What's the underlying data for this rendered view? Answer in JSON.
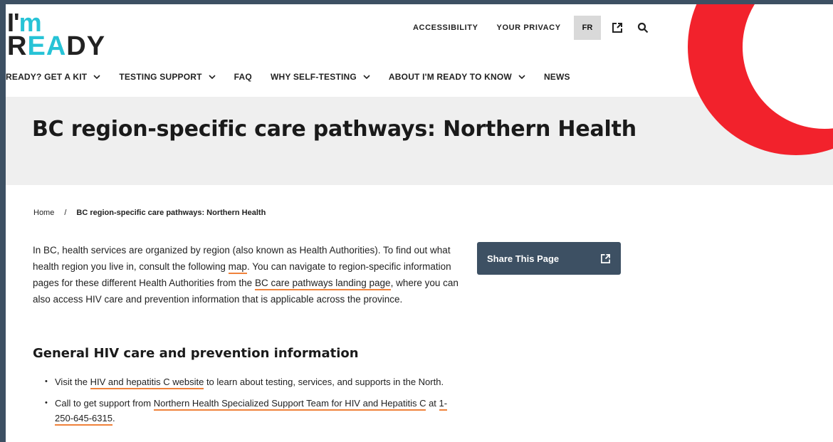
{
  "logo": {
    "line1_a": "I'",
    "line1_b": "m",
    "line2_a": "R",
    "line2_b": "E",
    "line2_c": "A",
    "line2_d": "DY"
  },
  "utility": {
    "accessibility": "ACCESSIBILITY",
    "privacy": "YOUR PRIVACY",
    "language": "FR",
    "external_icon": "external-link-icon",
    "search_icon": "search-icon"
  },
  "nav": {
    "items": [
      {
        "label": "READY? GET A KIT",
        "dropdown": true
      },
      {
        "label": "TESTING SUPPORT",
        "dropdown": true
      },
      {
        "label": "FAQ",
        "dropdown": false
      },
      {
        "label": "WHY SELF-TESTING",
        "dropdown": true
      },
      {
        "label": "ABOUT I'M READY TO KNOW",
        "dropdown": true
      },
      {
        "label": "NEWS",
        "dropdown": false
      }
    ]
  },
  "hero": {
    "title": "BC region-specific care pathways: Northern Health"
  },
  "breadcrumb": {
    "home": "Home",
    "separator": "/",
    "current": "BC region-specific care pathways: Northern Health"
  },
  "intro": {
    "t1": "In BC, health services are organized by region (also known as Health Authorities). To find out what health region you live in, consult the following ",
    "link_map": "map",
    "t2": ". You can navigate to region-specific information pages for these different Health Authorities from the ",
    "link_landing": "BC care pathways landing page",
    "t3": ", where you can also access HIV care and prevention information that is applicable across the province."
  },
  "section": {
    "heading": "General HIV care and prevention information",
    "b1_pre": "Visit the ",
    "b1_link": "HIV and hepatitis C website",
    "b1_post": " to learn about testing, services, and supports in the North.",
    "b2_pre": "Call to get support from ",
    "b2_link1": "Northern Health Specialized Support Team for HIV and Hepatitis C",
    "b2_mid": " at ",
    "b2_link2": "1-250-645-6315",
    "b2_post": "."
  },
  "share": {
    "label": "Share This Page",
    "icon": "external-link-icon"
  },
  "colors": {
    "accent_red": "#f2222c",
    "underline": "#f0823b",
    "share_bg": "#3d5063",
    "logo_cyan": "#27c3d6"
  }
}
